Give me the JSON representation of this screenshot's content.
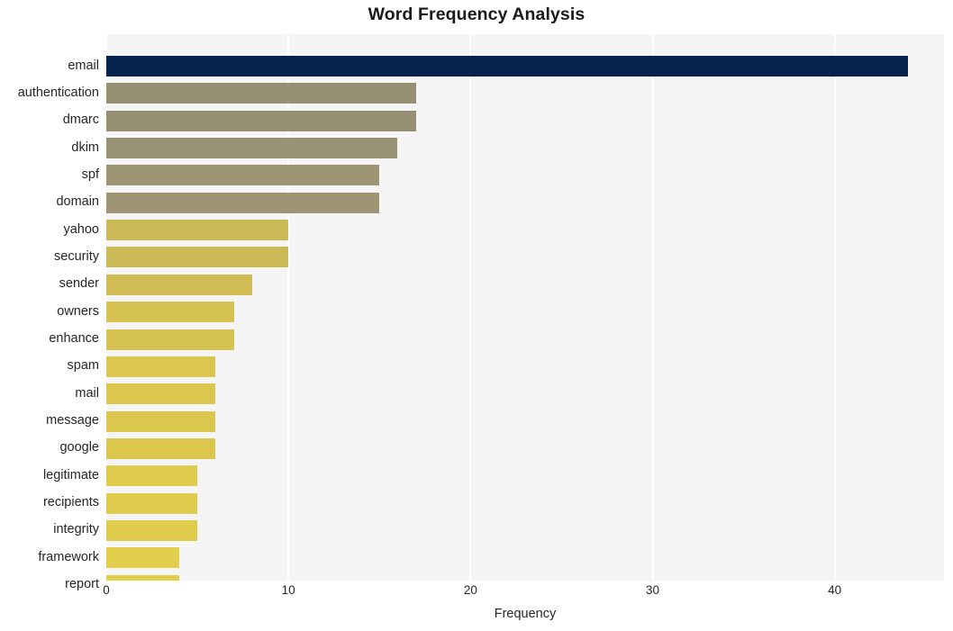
{
  "chart_data": {
    "type": "bar",
    "orientation": "horizontal",
    "title": "Word Frequency Analysis",
    "xlabel": "Frequency",
    "ylabel": "",
    "xlim": [
      0,
      46
    ],
    "xticks": [
      0,
      10,
      20,
      30,
      40
    ],
    "xtick_labels": [
      "0",
      "10",
      "20",
      "30",
      "40"
    ],
    "grid": "vertical-white",
    "legend": "none",
    "background": "#f5f5f5",
    "categories": [
      "email",
      "authentication",
      "dmarc",
      "dkim",
      "spf",
      "domain",
      "yahoo",
      "security",
      "sender",
      "owners",
      "enhance",
      "spam",
      "mail",
      "message",
      "google",
      "legitimate",
      "recipients",
      "integrity",
      "framework",
      "report"
    ],
    "values": [
      44,
      17,
      17,
      16,
      15,
      15,
      10,
      10,
      8,
      7,
      7,
      6,
      6,
      6,
      6,
      5,
      5,
      5,
      4,
      4
    ],
    "colors": [
      "#04244f",
      "#978f74",
      "#978f74",
      "#9a9275",
      "#9d9573",
      "#9d9573",
      "#cbb956",
      "#cbb956",
      "#d0bc52",
      "#d6c250",
      "#d6c250",
      "#dbc74e",
      "#dbc74e",
      "#dbc74e",
      "#dbc74e",
      "#dfcb4c",
      "#dfcb4c",
      "#dfcb4c",
      "#e2ce4a",
      "#e2ce4a"
    ]
  }
}
